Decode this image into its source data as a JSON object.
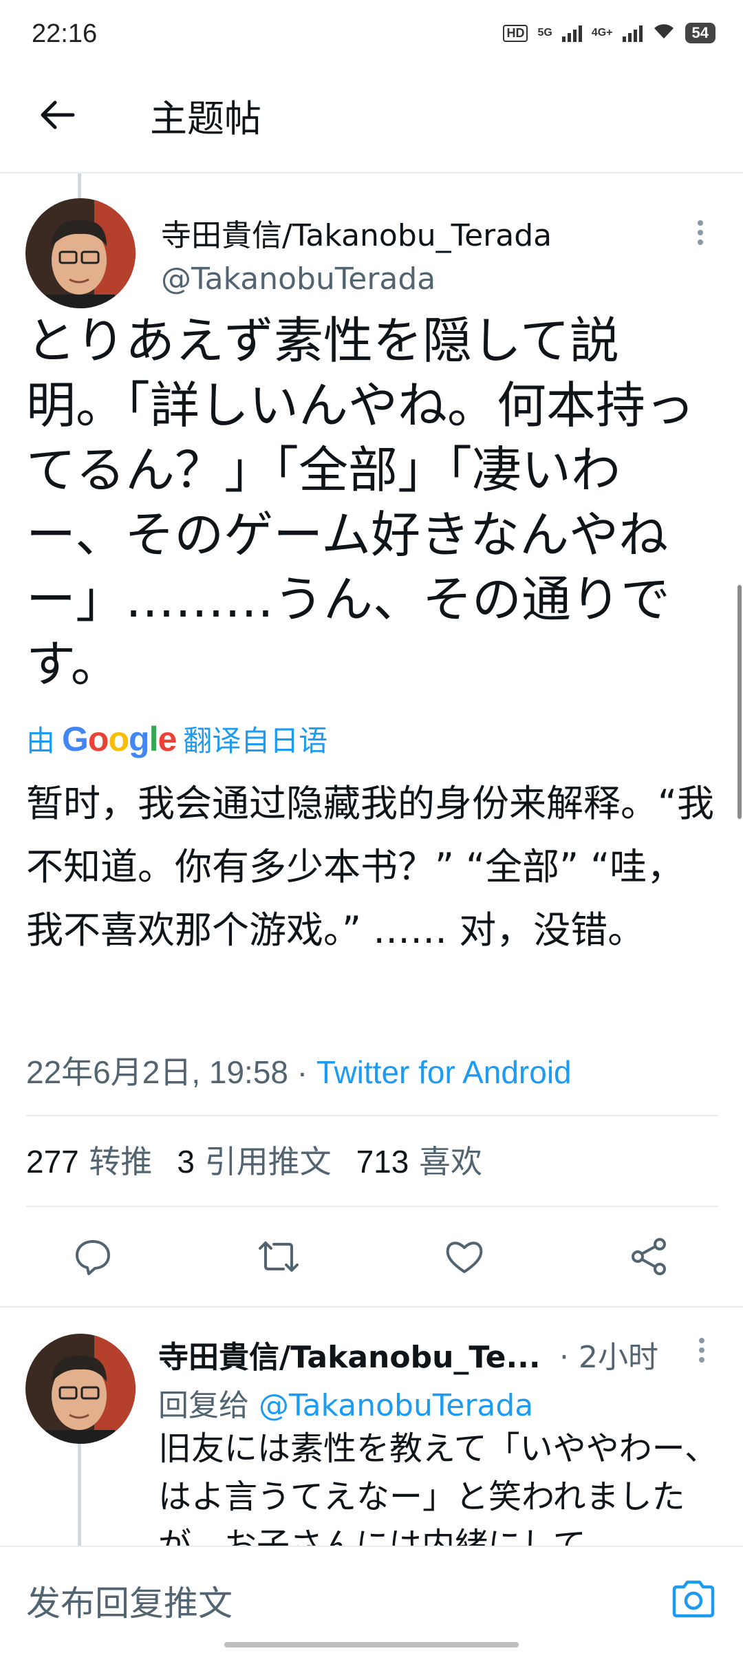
{
  "status_bar": {
    "time": "22:16",
    "hd": "HD",
    "sim1": "5G",
    "sim2": "4G+",
    "battery": "54"
  },
  "header": {
    "title": "主题帖"
  },
  "tweet": {
    "display_name": "寺田貴信/Takanobu_Terada",
    "handle": "@TakanobuTerada",
    "text": "とりあえず素性を隠して説明。「詳しいんやね。何本持ってるん？」「全部」「凄いわー、そのゲーム好きなんやねー」………うん、その通りです。",
    "translate_prefix": "由",
    "translate_brand": "Google",
    "translate_suffix": "翻译自日语",
    "translated_text": "暂时，我会通过隐藏我的身份来解释。“我不知道。你有多少本书？” “全部” “哇，我不喜欢那个游戏。” …… 对，没错。",
    "timestamp": "22年6月2日, 19:58",
    "source": "Twitter for Android",
    "retweets": "277",
    "retweets_label": "转推",
    "quotes": "3",
    "quotes_label": "引用推文",
    "likes": "713",
    "likes_label": "喜欢"
  },
  "reply": {
    "display_name": "寺田貴信/Takanobu_Te...",
    "time": "· 2小时",
    "reply_prefix": "回复给",
    "reply_to": "@TakanobuTerada",
    "text": "旧友には素性を教えて「いややわー、はよ言うてえなー」と笑われましたが、お子さんには内緒にして"
  },
  "composer": {
    "placeholder": "发布回复推文"
  },
  "colors": {
    "accent": "#1d9bf0",
    "secondary_text": "#536471",
    "divider": "#e6ecf0"
  }
}
